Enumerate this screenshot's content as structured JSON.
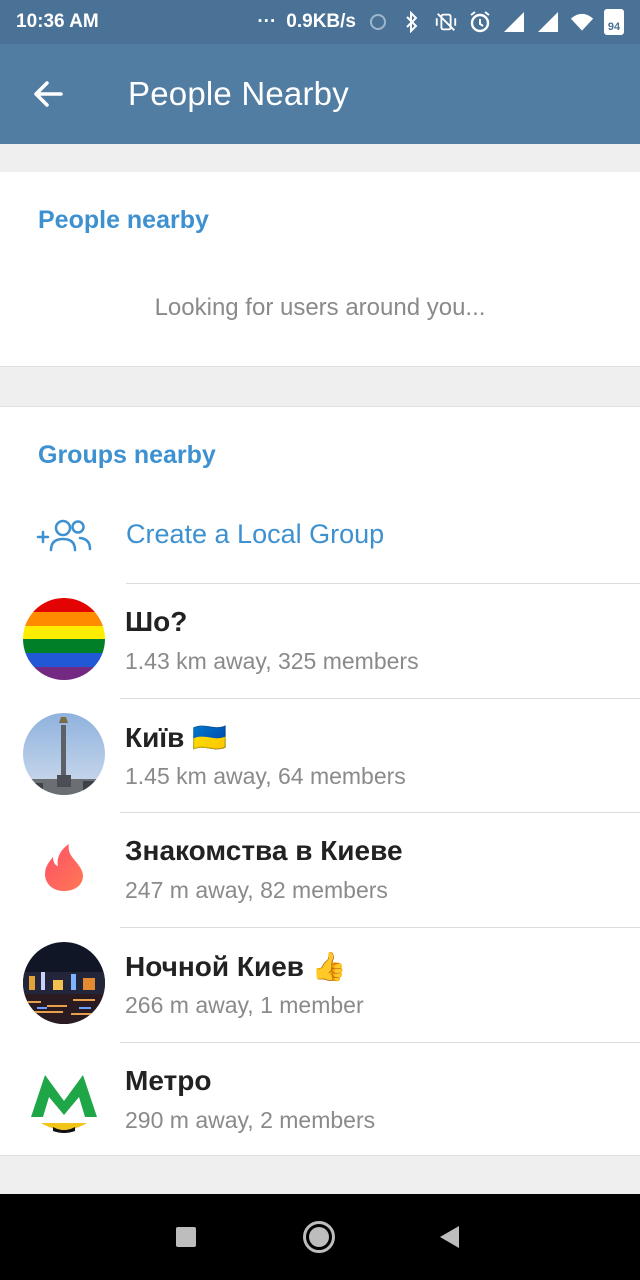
{
  "status_bar": {
    "time": "10:36 AM",
    "dots": "···",
    "speed": "0.9KB/s",
    "battery": "94",
    "icons": [
      "sync-icon",
      "bluetooth-icon",
      "vibrate-off-icon",
      "alarm-icon",
      "signal-icon",
      "signal-icon",
      "wifi-icon",
      "battery-icon"
    ]
  },
  "app_bar": {
    "title": "People Nearby",
    "back_icon": "arrow-left-icon"
  },
  "people_section": {
    "header": "People nearby",
    "status": "Looking for users around you..."
  },
  "groups_section": {
    "header": "Groups nearby",
    "create_label": "Create a Local Group",
    "create_icon": "add-group-icon",
    "groups": [
      {
        "name": "Шо?",
        "emoji": "",
        "subtitle": "1.43 km away, 325 members"
      },
      {
        "name": "Київ",
        "emoji": "🇺🇦",
        "subtitle": "1.45 km away, 64 members"
      },
      {
        "name": "Знакомства в Киеве",
        "emoji": "",
        "subtitle": "247 m away, 82 members"
      },
      {
        "name": "Ночной Киев",
        "emoji": "👍",
        "subtitle": "266 m away, 1 member"
      },
      {
        "name": "Метро",
        "emoji": "",
        "subtitle": "290 m away, 2 members"
      }
    ]
  },
  "colors": {
    "app_bar": "#527da3",
    "status_bar": "#4a7196",
    "accent": "#3e91d0"
  }
}
